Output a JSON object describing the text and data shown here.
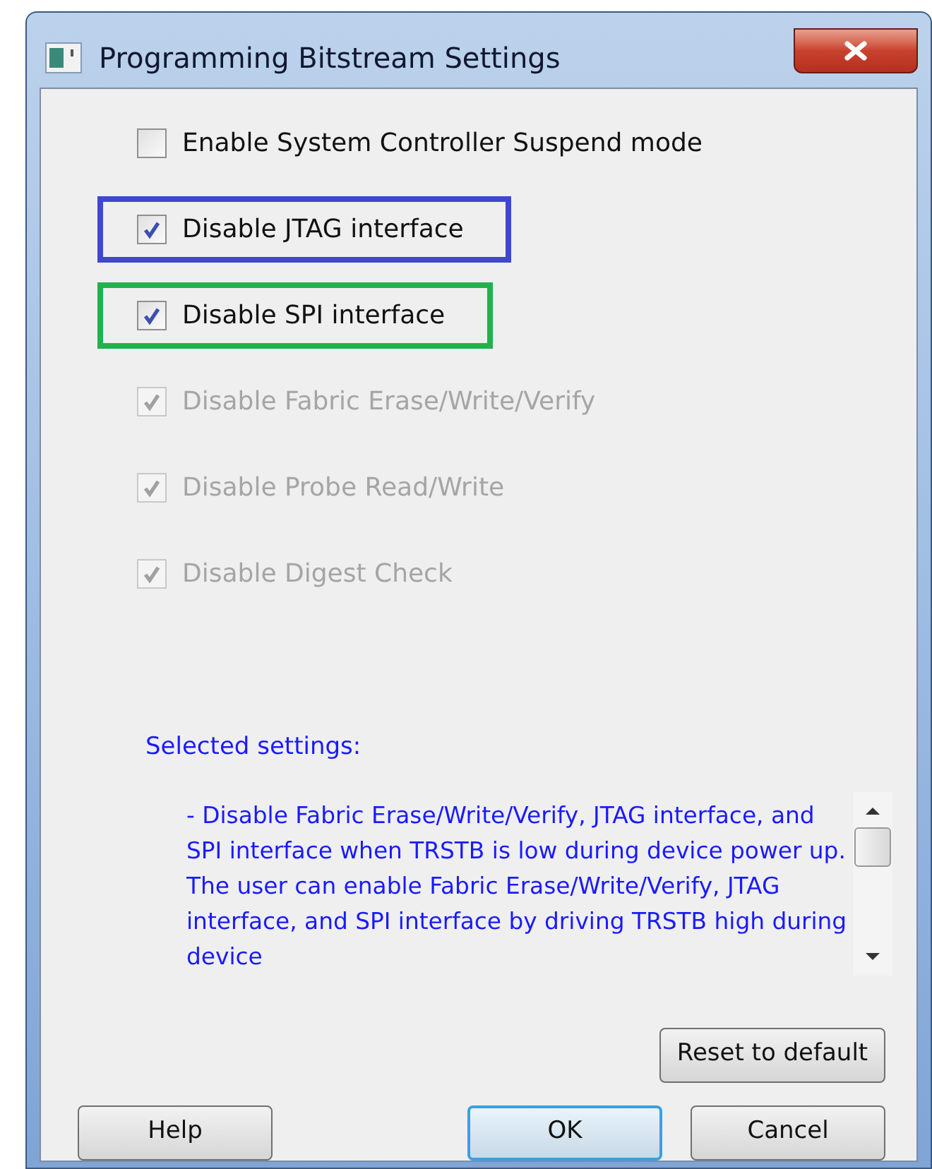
{
  "window": {
    "title": "Programming Bitstream Settings"
  },
  "options": [
    {
      "label": "Enable System Controller Suspend mode",
      "checked": false,
      "disabled": false
    },
    {
      "label": "Disable JTAG interface",
      "checked": true,
      "disabled": false,
      "color": "#3f48cc"
    },
    {
      "label": "Disable SPI interface",
      "checked": true,
      "disabled": false,
      "color": "#22b14c"
    },
    {
      "label": "Disable Fabric Erase/Write/Verify",
      "checked": true,
      "disabled": true
    },
    {
      "label": "Disable Probe Read/Write",
      "checked": true,
      "disabled": true
    },
    {
      "label": "Disable Digest Check",
      "checked": true,
      "disabled": true
    }
  ],
  "selected_settings": {
    "label": "Selected settings:",
    "text": "- Disable Fabric Erase/Write/Verify, JTAG interface, and SPI interface when TRSTB is low during device power up. The user can enable Fabric Erase/Write/Verify, JTAG interface, and SPI interface by driving TRSTB high during device"
  },
  "reset_button": "Reset to default",
  "buttons": [
    {
      "label": "Help",
      "default": false
    },
    {
      "label": "OK",
      "default": true
    },
    {
      "label": "Cancel",
      "default": false
    }
  ]
}
